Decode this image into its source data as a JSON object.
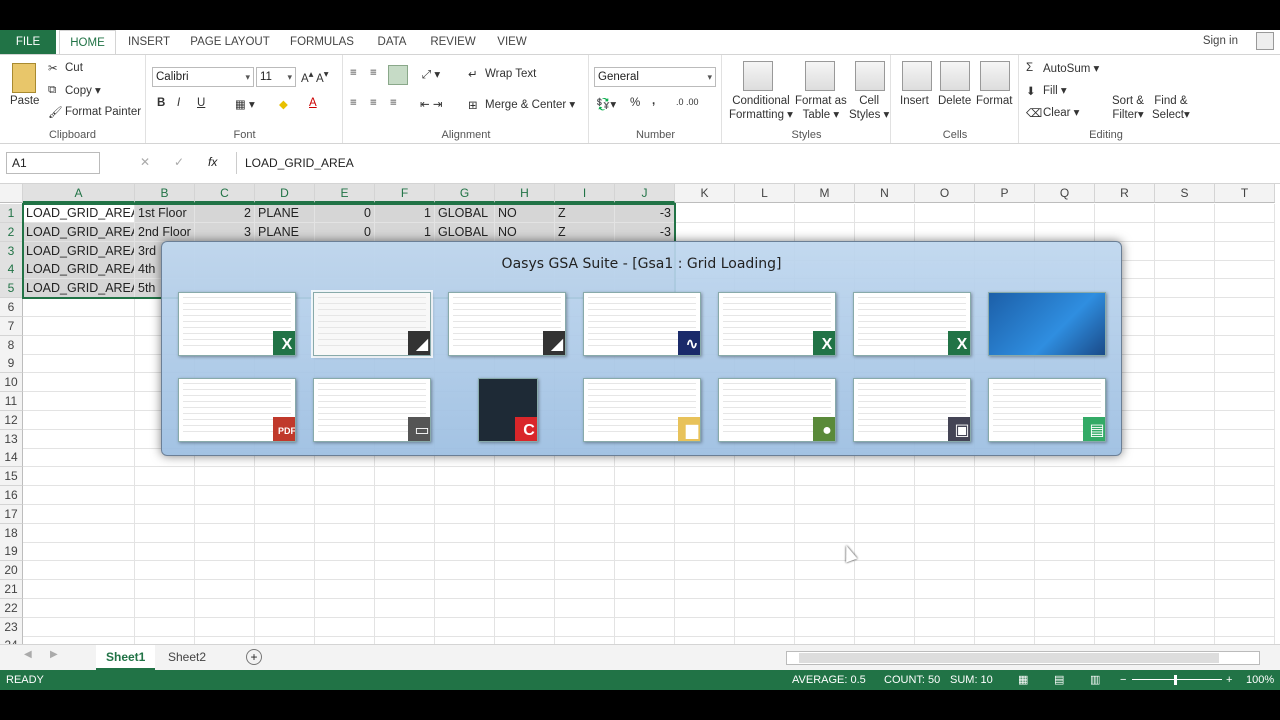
{
  "ribbon_tabs": [
    "FILE",
    "HOME",
    "INSERT",
    "PAGE LAYOUT",
    "FORMULAS",
    "DATA",
    "REVIEW",
    "VIEW"
  ],
  "signin": "Sign in",
  "clipboard": {
    "paste": "Paste",
    "cut": "Cut",
    "copy": "Copy",
    "format_painter": "Format Painter",
    "label": "Clipboard"
  },
  "font": {
    "name": "Calibri",
    "size": "11",
    "bold": "B",
    "italic": "I",
    "underline": "U",
    "label": "Font"
  },
  "alignment": {
    "wrap": "Wrap Text",
    "merge": "Merge & Center",
    "label": "Alignment"
  },
  "number": {
    "format": "General",
    "percent": "%",
    "comma": ",",
    "label": "Number"
  },
  "styles": {
    "conditional": "Conditional",
    "conditional2": "Formatting",
    "format_as": "Format as",
    "format_as2": "Table",
    "cell_styles": "Cell",
    "cell_styles2": "Styles",
    "label": "Styles"
  },
  "cells": {
    "insert": "Insert",
    "delete": "Delete",
    "format": "Format",
    "label": "Cells"
  },
  "editing": {
    "autosum": "AutoSum",
    "fill": "Fill",
    "clear": "Clear",
    "sort": "Sort &",
    "sort2": "Filter",
    "find": "Find &",
    "find2": "Select",
    "label": "Editing"
  },
  "formula_bar": {
    "name_box": "A1",
    "fx": "fx",
    "content": "LOAD_GRID_AREA"
  },
  "columns": [
    "A",
    "B",
    "C",
    "D",
    "E",
    "F",
    "G",
    "H",
    "I",
    "J",
    "K",
    "L",
    "M",
    "N",
    "O",
    "P",
    "Q",
    "R",
    "S",
    "T"
  ],
  "rows": [
    "1",
    "2",
    "3",
    "4",
    "5",
    "6",
    "7",
    "8",
    "9",
    "10",
    "11",
    "12",
    "13",
    "14",
    "15",
    "16",
    "17",
    "18",
    "19",
    "20",
    "21",
    "22",
    "23",
    "24"
  ],
  "cells_data": [
    [
      "LOAD_GRID_AREA",
      "1st Floor",
      "2",
      "PLANE",
      "0",
      "1",
      "GLOBAL",
      "NO",
      "Z",
      "-3"
    ],
    [
      "LOAD_GRID_AREA",
      "2nd Floor",
      "3",
      "PLANE",
      "0",
      "1",
      "GLOBAL",
      "NO",
      "Z",
      "-3"
    ],
    [
      "LOAD_GRID_AREA",
      "3rd",
      "",
      "",
      "",
      "",
      "",
      "",
      "",
      ""
    ],
    [
      "LOAD_GRID_AREA",
      "4th",
      "",
      "",
      "",
      "",
      "",
      "",
      "",
      ""
    ],
    [
      "LOAD_GRID_AREA",
      "5th",
      "",
      "",
      "",
      "",
      "",
      "",
      "",
      ""
    ]
  ],
  "switcher": {
    "title": "Oasys GSA Suite - [Gsa1 : Grid Loading]",
    "row1": [
      "excel",
      "gsa",
      "gsa-3d",
      "analysis",
      "excel",
      "excel",
      "desktop"
    ],
    "row2": [
      "pdf",
      "camstudio",
      "comodo",
      "folder",
      "notepad",
      "blank",
      "task"
    ]
  },
  "sheets": [
    "Sheet1",
    "Sheet2"
  ],
  "add_sheet": "+",
  "status": {
    "ready": "READY",
    "average": "AVERAGE: 0.5",
    "count": "COUNT: 50",
    "sum": "SUM: 10",
    "zoom": "100%",
    "minus": "−",
    "plus": "+"
  },
  "colors": {
    "excel_green": "#217346",
    "selection": "#d6d6d6"
  }
}
